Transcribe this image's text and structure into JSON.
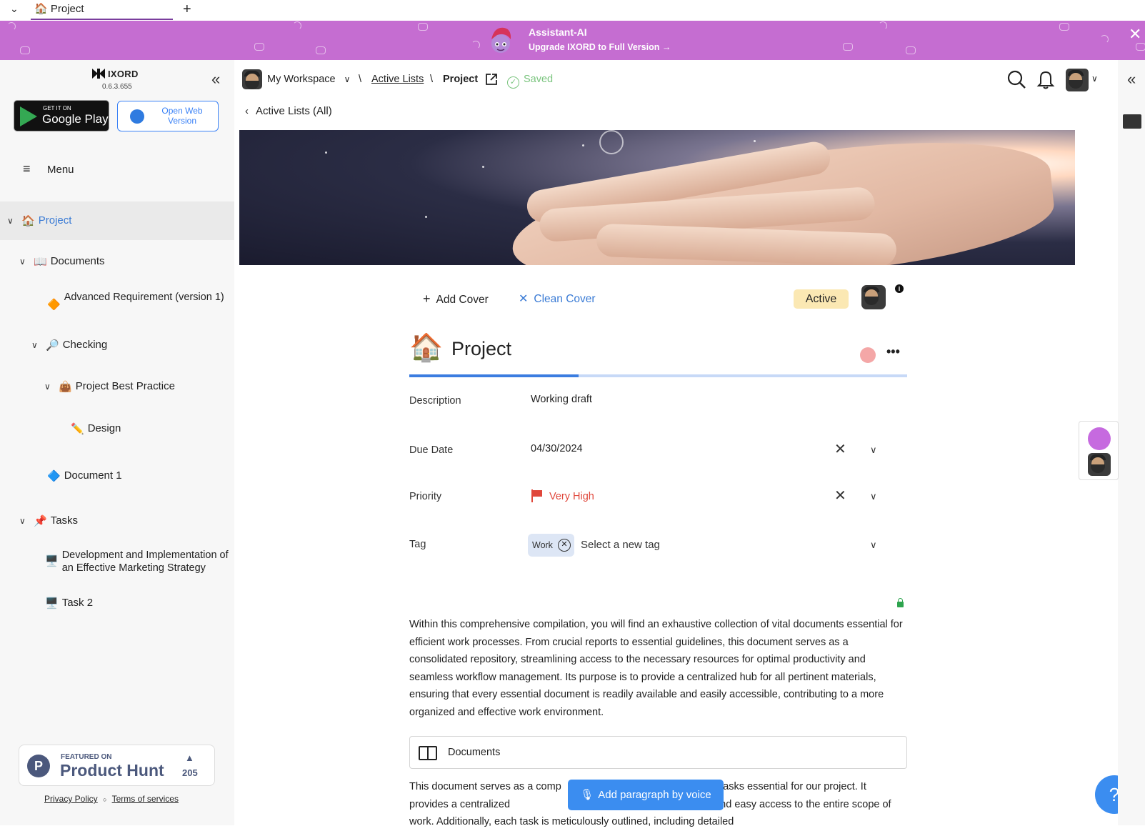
{
  "browser": {
    "tab_title": "Project",
    "tab_emoji": "🏠"
  },
  "banner": {
    "title": "Assistant-AI",
    "subtitle": "Upgrade IXORD to Full Version →"
  },
  "sidebar": {
    "app_name": "IXORD",
    "version": "0.6.3.655",
    "google_play": {
      "top": "GET IT ON",
      "name": "Google Play"
    },
    "open_web": "Open Web Version",
    "menu_label": "Menu",
    "tree": [
      {
        "emoji": "🏠",
        "label": "Project"
      },
      {
        "emoji": "📖",
        "label": "Documents"
      },
      {
        "emoji": "🔶",
        "label": "Advanced Requirement (version 1)"
      },
      {
        "emoji": "🔎",
        "label": "Checking"
      },
      {
        "emoji": "👜",
        "label": "Project Best Practice"
      },
      {
        "emoji": "✏️",
        "label": "Design"
      },
      {
        "emoji": "🔷",
        "label": "Document 1"
      },
      {
        "emoji": "📌",
        "label": "Tasks"
      },
      {
        "emoji": "🖥️",
        "label": "Development and Implementation of an Effective Marketing Strategy"
      },
      {
        "emoji": "🖥️",
        "label": "Task 2"
      }
    ],
    "product_hunt": {
      "featured": "FEATURED ON",
      "name": "Product Hunt",
      "votes": "205"
    },
    "privacy": "Privacy Policy",
    "separator": "○",
    "terms": "Terms of services"
  },
  "header": {
    "workspace": "My Workspace",
    "sep": "\\",
    "breadcrumb_lists": "Active Lists",
    "breadcrumb_current": "Project",
    "saved": "Saved",
    "back_link": "Active Lists (All)"
  },
  "document": {
    "add_cover": "Add Cover",
    "clean_cover": "Clean Cover",
    "status": "Active",
    "emoji": "🏠",
    "title": "Project",
    "progress": 0.34,
    "fields": {
      "description_label": "Description",
      "description_value": "Working draft",
      "due_label": "Due Date",
      "due_value": "04/30/2024",
      "priority_label": "Priority",
      "priority_value": "Very High",
      "tag_label": "Tag",
      "tag_value": "Work",
      "tag_placeholder": "Select a new tag"
    },
    "paragraph1": "Within this comprehensive compilation, you will find an exhaustive collection of vital documents essential for efficient work processes. From crucial reports to essential guidelines, this document serves as a consolidated repository, streamlining access to the necessary resources for optimal productivity and seamless workflow management. Its purpose is to provide a centralized hub for all pertinent materials, ensuring that every essential document is readily available and easily accessible, contributing to a more organized and effective work environment.",
    "block_label": "Documents",
    "paragraph2": "This document serves as a comp                                     sing all the tasks essential for our project. It provides a centralized                                     ents, ensuring clarity and easy access to the entire scope of work. Additionally, each task is meticulously outlined, including detailed",
    "voice_button": "Add paragraph by voice",
    "help": "?"
  },
  "colors": {
    "banner": "#c56dd1",
    "accent": "#3b7de0",
    "status_badge": "#fbe8b3",
    "priority": "#e0473b",
    "saved": "#7ac47e"
  }
}
